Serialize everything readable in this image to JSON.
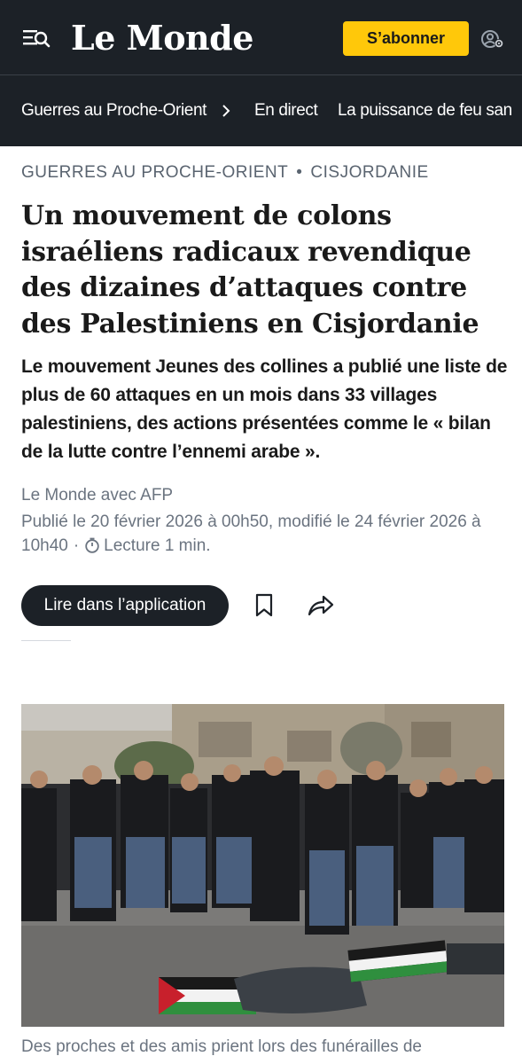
{
  "header": {
    "logo": "Le Monde",
    "subscribe_label": "S’abonner"
  },
  "nav": {
    "items": [
      {
        "label": "Guerres au Proche-Orient"
      },
      {
        "label": "En direct"
      },
      {
        "label": "La puissance de feu san"
      }
    ]
  },
  "article": {
    "kicker": {
      "section": "GUERRES AU PROCHE-ORIENT",
      "separator": "•",
      "topic": "CISJORDANIE"
    },
    "headline": "Un mouvement de colons israéliens radicaux revendique des dizaines d’attaques contre des Palestiniens en Cisjordanie",
    "standfirst": "Le mouvement Jeunes des collines a publié une liste de plus de 60 attaques en un mois dans 33 villages palestiniens, des actions présentées comme le « bilan de la lutte contre l’ennemi arabe ».",
    "byline": "Le Monde avec AFP",
    "dates": "Publié le 20 février 2026 à 00h50, modifié le 24 février 2026 à 10h40",
    "dot": "·",
    "reading_time": "Lecture 1 min.",
    "app_button_label": "Lire dans l’application",
    "caption": "Des proches et des amis prient lors des funérailles de"
  },
  "colors": {
    "header_bg": "#1c2127",
    "subscribe_bg": "#ffc80a",
    "muted_text": "#6b7480"
  },
  "icons": [
    "menu-search-icon",
    "account-settings-icon",
    "chevron-right-icon",
    "timer-icon",
    "bookmark-icon",
    "share-icon"
  ]
}
